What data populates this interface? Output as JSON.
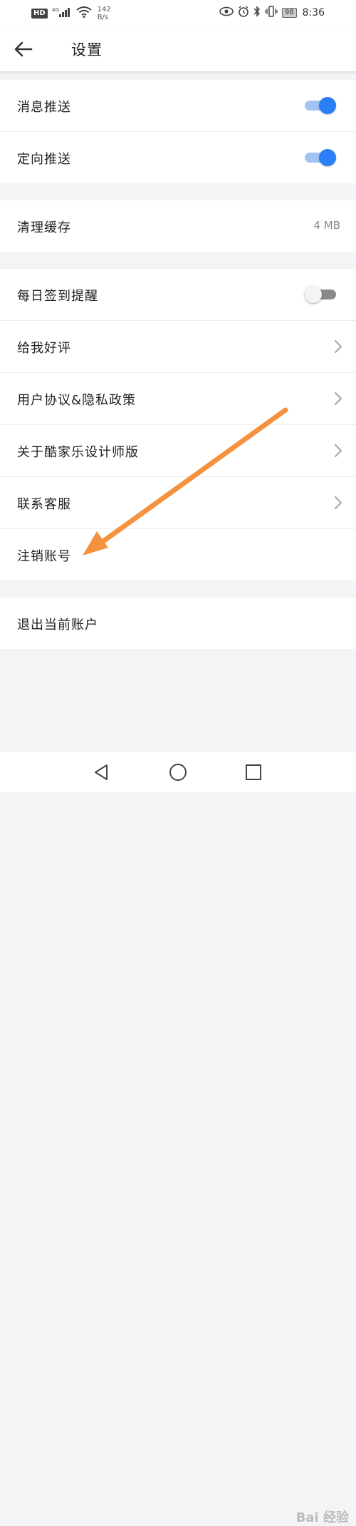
{
  "status_bar": {
    "hd": "HD",
    "network": "4G",
    "speed_value": "142",
    "speed_unit": "B/s",
    "battery": "98",
    "time": "8:36"
  },
  "header": {
    "title": "设置"
  },
  "groups": {
    "push": [
      {
        "label": "消息推送",
        "toggle": "on"
      },
      {
        "label": "定向推送",
        "toggle": "on"
      }
    ],
    "cache": {
      "label": "清理缓存",
      "value": "4 MB"
    },
    "misc": [
      {
        "label": "每日签到提醒",
        "toggle": "off"
      },
      {
        "label": "给我好评"
      },
      {
        "label": "用户协议&隐私政策"
      },
      {
        "label": "关于酷家乐设计师版"
      },
      {
        "label": "联系客服"
      },
      {
        "label": "注销账号"
      }
    ],
    "logout": {
      "label": "退出当前账户"
    }
  },
  "colors": {
    "toggle_on": "#2b7ff6",
    "annotation_arrow": "#f5923e"
  },
  "watermark": "Bai 经验"
}
